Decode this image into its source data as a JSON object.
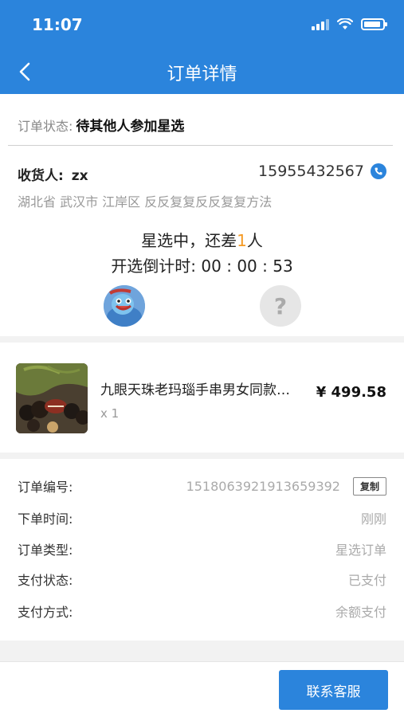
{
  "status_bar": {
    "time": "11:07"
  },
  "nav": {
    "title": "订单详情"
  },
  "order_status": {
    "label": "订单状态:",
    "value": "待其他人参加星选"
  },
  "receiver": {
    "label": "收货人:",
    "name": "zx",
    "phone": "15955432567",
    "address": "湖北省 武汉市 江岸区 反反复复反反复复方法"
  },
  "group": {
    "line1_prefix": "星选中，还差",
    "remaining": "1",
    "line1_suffix": "人",
    "countdown_label": "开选倒计时:",
    "countdown": "00 : 00 : 53"
  },
  "product": {
    "name": "九眼天珠老玛瑙手串男女同款…",
    "qty": "x 1",
    "price": "¥ 499.58"
  },
  "order_info": [
    {
      "label": "订单编号:",
      "value": "1518063921913659392",
      "action": "复制"
    },
    {
      "label": "下单时间:",
      "value": "刚刚"
    },
    {
      "label": "订单类型:",
      "value": "星选订单"
    },
    {
      "label": "支付状态:",
      "value": "已支付"
    },
    {
      "label": "支付方式:",
      "value": "余额支付"
    }
  ],
  "bottom": {
    "contact_label": "联系客服"
  },
  "colors": {
    "primary": "#2b84dc",
    "accent": "#f59a23"
  },
  "icons": [
    "back-icon",
    "signal-icon",
    "wifi-icon",
    "battery-icon",
    "phone-icon",
    "question-icon"
  ]
}
